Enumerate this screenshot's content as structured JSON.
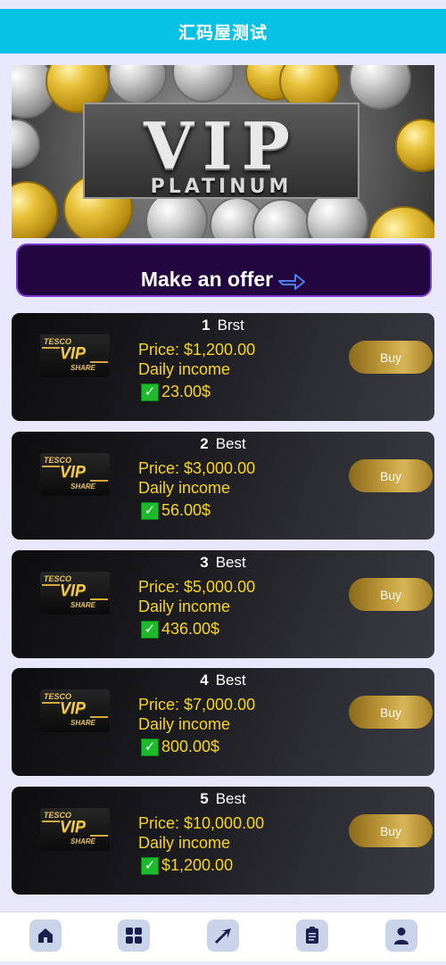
{
  "header": {
    "title": "汇码屋测试"
  },
  "banner": {
    "headline": "VIP",
    "subline": "PLATINUM"
  },
  "offer": {
    "label": "Make an offer"
  },
  "logo": {
    "line1": "TESCO",
    "line2": "VIP",
    "line3": "SHARE"
  },
  "products": [
    {
      "number": "1",
      "tag": "Brst",
      "price": "Price: $1,200.00",
      "daily": "Daily income",
      "income": "23.00$",
      "buy": "Buy"
    },
    {
      "number": "2",
      "tag": "Best",
      "price": "Price: $3,000.00",
      "daily": "Daily income",
      "income": "56.00$",
      "buy": "Buy"
    },
    {
      "number": "3",
      "tag": "Best",
      "price": "Price: $5,000.00",
      "daily": "Daily income",
      "income": "436.00$",
      "buy": "Buy"
    },
    {
      "number": "4",
      "tag": "Best",
      "price": "Price: $7,000.00",
      "daily": "Daily income",
      "income": "800.00$",
      "buy": "Buy"
    },
    {
      "number": "5",
      "tag": "Best",
      "price": "Price: $10,000.00",
      "daily": "Daily income",
      "income": "$1,200.00",
      "buy": "Buy"
    }
  ],
  "tabbar": {
    "items": [
      {
        "icon": "home-icon"
      },
      {
        "icon": "grid-icon"
      },
      {
        "icon": "share-arrow-icon"
      },
      {
        "icon": "clipboard-icon"
      },
      {
        "icon": "user-icon"
      }
    ]
  },
  "colors": {
    "header": "#08c2e6",
    "price": "#f7d51a",
    "offer_bg": "#23063f",
    "check": "#1dbb2c"
  }
}
